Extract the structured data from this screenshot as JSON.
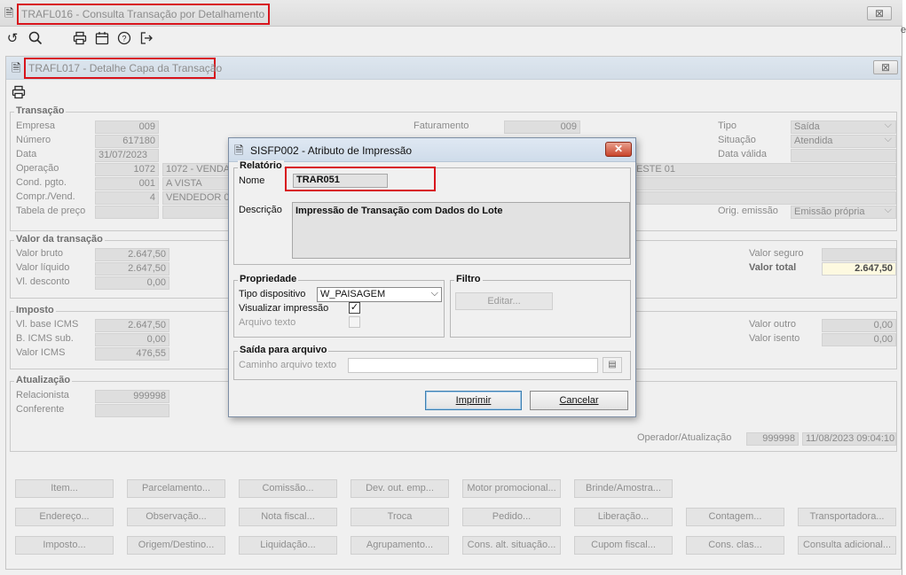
{
  "outer": {
    "title": "TRAFL016 - Consulta Transação por Detalhamento",
    "close": "⊠"
  },
  "side_glyph": "e",
  "inner": {
    "title": "TRAFL017 - Detalhe Capa da Transação",
    "close": "⊠"
  },
  "transacao": {
    "title": "Transação",
    "empresa": {
      "label": "Empresa",
      "value": "009"
    },
    "numero": {
      "label": "Número",
      "value": "617180"
    },
    "data": {
      "label": "Data",
      "value": "31/07/2023"
    },
    "operacao": {
      "label": "Operação",
      "code": "1072",
      "desc": "1072 - VENDA"
    },
    "cond_pgto": {
      "label": "Cond. pgto.",
      "code": "001",
      "desc": "A VISTA"
    },
    "compr_vend": {
      "label": "Compr./Vend.",
      "code": "4",
      "desc": "VENDEDOR 04"
    },
    "tabela_preco": {
      "label": "Tabela de preço",
      "code": "",
      "desc": ""
    },
    "faturamento": {
      "label": "Faturamento",
      "value": "009"
    },
    "middle_row1": "ESTE 01",
    "tipo": {
      "label": "Tipo",
      "value": "Saída"
    },
    "situacao": {
      "label": "Situação",
      "value": "Atendida"
    },
    "data_valida": {
      "label": "Data válida",
      "value": ""
    },
    "orig_emissao": {
      "label": "Orig. emissão",
      "value": "Emissão própria"
    }
  },
  "valor": {
    "title": "Valor da transação",
    "bruto": {
      "label": "Valor bruto",
      "value": "2.647,50"
    },
    "liquido": {
      "label": "Valor líquido",
      "value": "2.647,50"
    },
    "desconto": {
      "label": "Vl. desconto",
      "value": "0,00"
    },
    "seguro": {
      "label": "Valor seguro",
      "value": ""
    },
    "total": {
      "label": "Valor total",
      "value": "2.647,50"
    }
  },
  "imposto": {
    "title": "Imposto",
    "base_icms": {
      "label": "Vl. base ICMS",
      "value": "2.647,50"
    },
    "icms_sub": {
      "label": "B. ICMS sub.",
      "value": "0,00"
    },
    "valor_icms": {
      "label": "Valor ICMS",
      "value": "476,55"
    },
    "outro": {
      "label": "Valor outro",
      "value": "0,00"
    },
    "isento": {
      "label": "Valor isento",
      "value": "0,00"
    }
  },
  "atualizacao": {
    "title": "Atualização",
    "relacionista": {
      "label": "Relacionista",
      "value": "999998"
    },
    "conferente": {
      "label": "Conferente",
      "value": ""
    },
    "operador": {
      "label": "Operador/Atualização",
      "code": "999998",
      "datetime": "11/08/2023 09:04:10"
    }
  },
  "buttons": {
    "row1": [
      "Item...",
      "Parcelamento...",
      "Comissão...",
      "Dev. out. emp...",
      "Motor promocional...",
      "Brinde/Amostra..."
    ],
    "row2": [
      "Endereço...",
      "Observação...",
      "Nota fiscal...",
      "Troca",
      "Pedido...",
      "Liberação...",
      "Contagem...",
      "Transportadora..."
    ],
    "row3": [
      "Imposto...",
      "Origem/Destino...",
      "Liquidação...",
      "Agrupamento...",
      "Cons. alt. situação...",
      "Cupom fiscal...",
      "Cons. clas...",
      "Consulta adicional..."
    ]
  },
  "dialog": {
    "title": "SISFP002 - Atributo de Impressão",
    "close": "✕",
    "relatorio": {
      "title": "Relatório",
      "nome_label": "Nome",
      "nome_value": "TRAR051",
      "descricao_label": "Descrição",
      "descricao_value": "Impressão de Transação com Dados do Lote"
    },
    "propriedade": {
      "title": "Propriedade",
      "tipo_label": "Tipo dispositivo",
      "tipo_value": "W_PAISAGEM",
      "visualizar_label": "Visualizar impressão",
      "visualizar_checked": true,
      "arquivo_label": "Arquivo texto",
      "arquivo_checked": false
    },
    "filtro": {
      "title": "Filtro",
      "editar": "Editar..."
    },
    "saida": {
      "title": "Saída para arquivo",
      "caminho_label": "Caminho arquivo texto",
      "caminho_value": ""
    },
    "imprimir": "Imprimir",
    "cancelar": "Cancelar"
  },
  "colors": {
    "highlight": "#d8141c",
    "total_bg": "#fdf9e0"
  }
}
